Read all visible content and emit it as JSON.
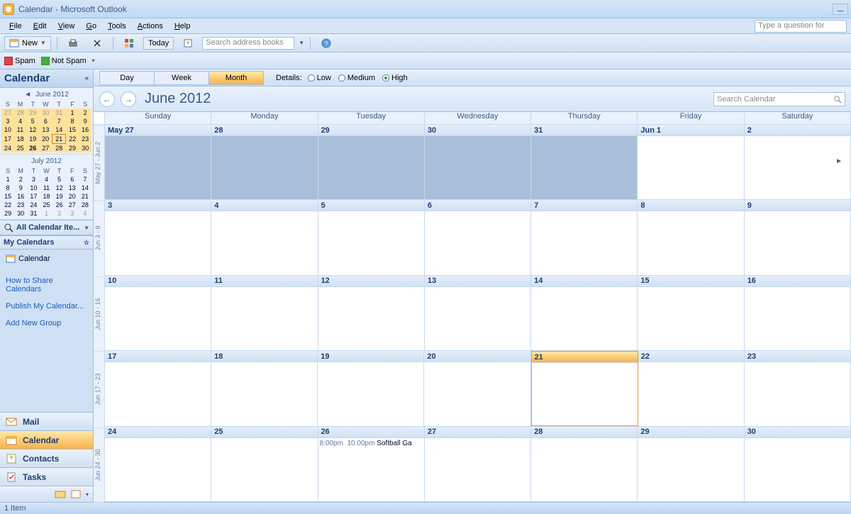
{
  "window": {
    "title": "Calendar - Microsoft Outlook"
  },
  "menu": [
    "File",
    "Edit",
    "View",
    "Go",
    "Tools",
    "Actions",
    "Help"
  ],
  "help_placeholder": "Type a question for",
  "toolbar": {
    "new": "New",
    "today": "Today",
    "search_placeholder": "Search address books"
  },
  "spam": {
    "spam": "Spam",
    "notspam": "Not Spam"
  },
  "nav": {
    "header": "Calendar",
    "minical1": {
      "title": "June 2012",
      "dow": [
        "S",
        "M",
        "T",
        "W",
        "T",
        "F",
        "S"
      ],
      "rows": [
        [
          {
            "v": "27",
            "c": "prev hl"
          },
          {
            "v": "28",
            "c": "prev hl"
          },
          {
            "v": "29",
            "c": "prev hl"
          },
          {
            "v": "30",
            "c": "prev hl"
          },
          {
            "v": "31",
            "c": "prev hl"
          },
          {
            "v": "1",
            "c": "hl"
          },
          {
            "v": "2",
            "c": "hl"
          }
        ],
        [
          {
            "v": "3",
            "c": "hl"
          },
          {
            "v": "4",
            "c": "hl"
          },
          {
            "v": "5",
            "c": "hl"
          },
          {
            "v": "6",
            "c": "hl"
          },
          {
            "v": "7",
            "c": "hl"
          },
          {
            "v": "8",
            "c": "hl"
          },
          {
            "v": "9",
            "c": "hl"
          }
        ],
        [
          {
            "v": "10",
            "c": "hl"
          },
          {
            "v": "11",
            "c": "hl"
          },
          {
            "v": "12",
            "c": "hl"
          },
          {
            "v": "13",
            "c": "hl"
          },
          {
            "v": "14",
            "c": "hl"
          },
          {
            "v": "15",
            "c": "hl"
          },
          {
            "v": "16",
            "c": "hl"
          }
        ],
        [
          {
            "v": "17",
            "c": "hl"
          },
          {
            "v": "18",
            "c": "hl"
          },
          {
            "v": "19",
            "c": "hl"
          },
          {
            "v": "20",
            "c": "hl"
          },
          {
            "v": "21",
            "c": "hl today"
          },
          {
            "v": "22",
            "c": "hl"
          },
          {
            "v": "23",
            "c": "hl"
          }
        ],
        [
          {
            "v": "24",
            "c": "hl"
          },
          {
            "v": "25",
            "c": "hl"
          },
          {
            "v": "26",
            "c": "hl bold"
          },
          {
            "v": "27",
            "c": "hl"
          },
          {
            "v": "28",
            "c": "hl"
          },
          {
            "v": "29",
            "c": "hl"
          },
          {
            "v": "30",
            "c": "hl"
          }
        ]
      ]
    },
    "minical2": {
      "title": "July 2012",
      "dow": [
        "S",
        "M",
        "T",
        "W",
        "T",
        "F",
        "S"
      ],
      "rows": [
        [
          {
            "v": "1",
            "c": ""
          },
          {
            "v": "2",
            "c": ""
          },
          {
            "v": "3",
            "c": ""
          },
          {
            "v": "4",
            "c": ""
          },
          {
            "v": "5",
            "c": ""
          },
          {
            "v": "6",
            "c": ""
          },
          {
            "v": "7",
            "c": ""
          }
        ],
        [
          {
            "v": "8",
            "c": ""
          },
          {
            "v": "9",
            "c": ""
          },
          {
            "v": "10",
            "c": ""
          },
          {
            "v": "11",
            "c": ""
          },
          {
            "v": "12",
            "c": ""
          },
          {
            "v": "13",
            "c": ""
          },
          {
            "v": "14",
            "c": ""
          }
        ],
        [
          {
            "v": "15",
            "c": ""
          },
          {
            "v": "16",
            "c": ""
          },
          {
            "v": "17",
            "c": ""
          },
          {
            "v": "18",
            "c": ""
          },
          {
            "v": "19",
            "c": ""
          },
          {
            "v": "20",
            "c": ""
          },
          {
            "v": "21",
            "c": ""
          }
        ],
        [
          {
            "v": "22",
            "c": ""
          },
          {
            "v": "23",
            "c": ""
          },
          {
            "v": "24",
            "c": ""
          },
          {
            "v": "25",
            "c": ""
          },
          {
            "v": "26",
            "c": ""
          },
          {
            "v": "27",
            "c": ""
          },
          {
            "v": "28",
            "c": ""
          }
        ],
        [
          {
            "v": "29",
            "c": ""
          },
          {
            "v": "30",
            "c": ""
          },
          {
            "v": "31",
            "c": ""
          },
          {
            "v": "1",
            "c": "next"
          },
          {
            "v": "2",
            "c": "next"
          },
          {
            "v": "3",
            "c": "next"
          },
          {
            "v": "4",
            "c": "next"
          }
        ]
      ]
    },
    "allitems": "All Calendar Ite...",
    "mycals": "My Calendars",
    "calitem": "Calendar",
    "links": [
      "How to Share Calendars",
      "Publish My Calendar...",
      "Add New Group"
    ],
    "bigbtns": [
      "Mail",
      "Calendar",
      "Contacts",
      "Tasks"
    ]
  },
  "view": {
    "tabs": [
      "Day",
      "Week",
      "Month"
    ],
    "active": "Month",
    "details_label": "Details:",
    "details": [
      "Low",
      "Medium",
      "High"
    ],
    "details_selected": "High"
  },
  "cal": {
    "title": "June 2012",
    "search_placeholder": "Search Calendar",
    "dow": [
      "Sunday",
      "Monday",
      "Tuesday",
      "Wednesday",
      "Thursday",
      "Friday",
      "Saturday"
    ],
    "weeknums": [
      "May 27 - Jun 2",
      "Jun 3 - 9",
      "Jun 10 - 16",
      "Jun 17 - 23",
      "Jun 24 - 30"
    ],
    "weeks": [
      [
        {
          "label": "May 27",
          "past": true
        },
        {
          "label": "28",
          "past": true
        },
        {
          "label": "29",
          "past": true
        },
        {
          "label": "30",
          "past": true
        },
        {
          "label": "31",
          "past": true
        },
        {
          "label": "Jun 1"
        },
        {
          "label": "2"
        }
      ],
      [
        {
          "label": "3"
        },
        {
          "label": "4"
        },
        {
          "label": "5"
        },
        {
          "label": "6"
        },
        {
          "label": "7"
        },
        {
          "label": "8"
        },
        {
          "label": "9"
        }
      ],
      [
        {
          "label": "10"
        },
        {
          "label": "11"
        },
        {
          "label": "12"
        },
        {
          "label": "13"
        },
        {
          "label": "14"
        },
        {
          "label": "15"
        },
        {
          "label": "16"
        }
      ],
      [
        {
          "label": "17"
        },
        {
          "label": "18"
        },
        {
          "label": "19"
        },
        {
          "label": "20"
        },
        {
          "label": "21",
          "today": true
        },
        {
          "label": "22"
        },
        {
          "label": "23"
        }
      ],
      [
        {
          "label": "24"
        },
        {
          "label": "25"
        },
        {
          "label": "26",
          "event": {
            "start": "8:00pm",
            "end": "10:00pm",
            "title": "Softball Ga"
          }
        },
        {
          "label": "27"
        },
        {
          "label": "28"
        },
        {
          "label": "29"
        },
        {
          "label": "30"
        }
      ]
    ]
  },
  "status": "1 Item"
}
